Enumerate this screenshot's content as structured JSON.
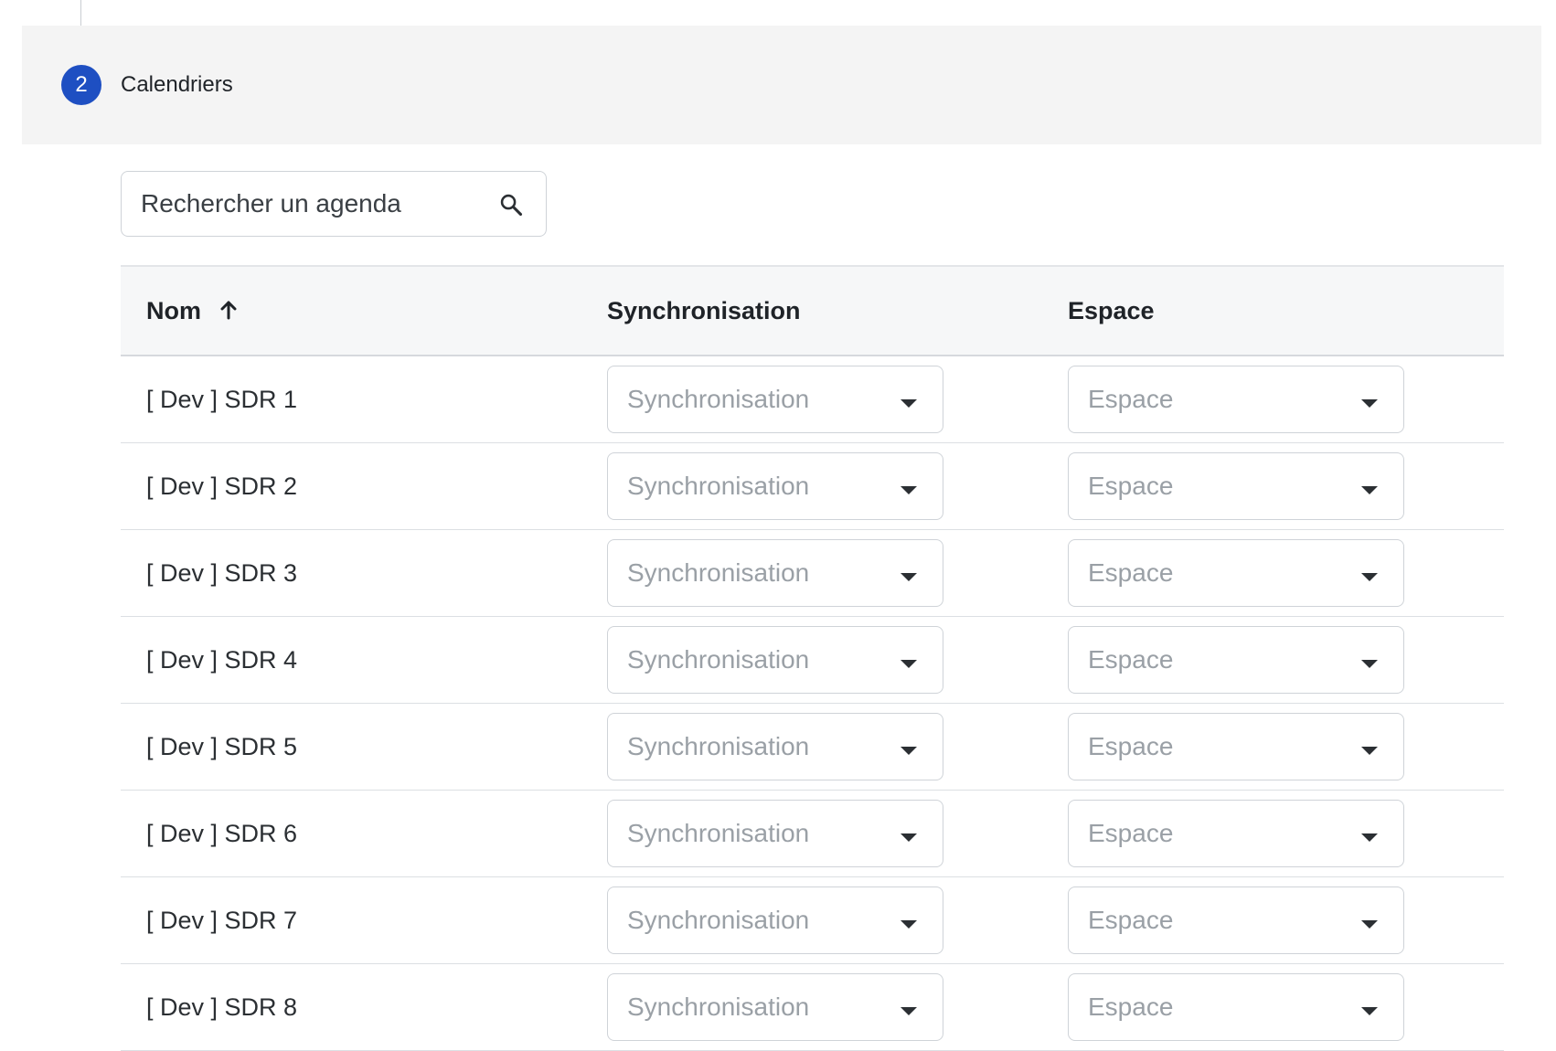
{
  "step": {
    "number": "2",
    "title": "Calendriers"
  },
  "search": {
    "placeholder": "Rechercher un agenda",
    "icon": "search-icon"
  },
  "table": {
    "columns": {
      "name": "Nom",
      "sync": "Synchronisation",
      "space": "Espace"
    },
    "sort": {
      "column": "name",
      "direction": "ascending",
      "icon": "arrow-up-icon"
    },
    "rows": [
      {
        "name": "[ Dev ] SDR 1",
        "sync_placeholder": "Synchronisation",
        "space_placeholder": "Espace"
      },
      {
        "name": "[ Dev ] SDR 2",
        "sync_placeholder": "Synchronisation",
        "space_placeholder": "Espace"
      },
      {
        "name": "[ Dev ] SDR 3",
        "sync_placeholder": "Synchronisation",
        "space_placeholder": "Espace"
      },
      {
        "name": "[ Dev ] SDR 4",
        "sync_placeholder": "Synchronisation",
        "space_placeholder": "Espace"
      },
      {
        "name": "[ Dev ] SDR 5",
        "sync_placeholder": "Synchronisation",
        "space_placeholder": "Espace"
      },
      {
        "name": "[ Dev ] SDR 6",
        "sync_placeholder": "Synchronisation",
        "space_placeholder": "Espace"
      },
      {
        "name": "[ Dev ] SDR 7",
        "sync_placeholder": "Synchronisation",
        "space_placeholder": "Espace"
      },
      {
        "name": "[ Dev ] SDR 8",
        "sync_placeholder": "Synchronisation",
        "space_placeholder": "Espace"
      }
    ]
  },
  "colors": {
    "accent": "#1e4fc2",
    "header_bg": "#f4f4f4",
    "table_header_bg": "#f6f7f8",
    "placeholder_text": "#9aa0a6"
  }
}
